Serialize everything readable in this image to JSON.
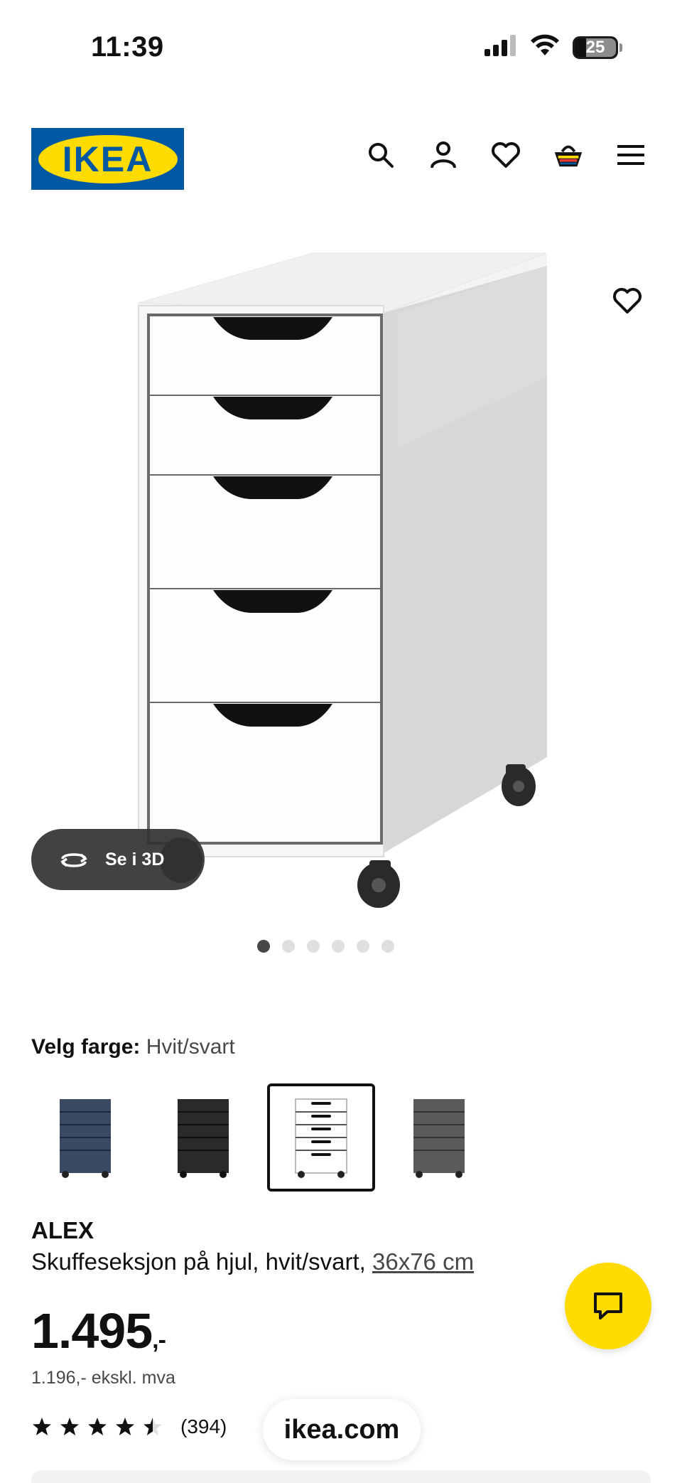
{
  "status_bar": {
    "time": "11:39",
    "battery": "25"
  },
  "header": {
    "logo_text": "IKEA",
    "brand_colors": {
      "blue": "#0058a3",
      "yellow": "#ffdb00"
    },
    "icons": [
      "search-icon",
      "account-icon",
      "heart-icon",
      "basket-icon",
      "menu-icon"
    ]
  },
  "gallery": {
    "view_3d_label": "Se i 3D",
    "dots_count": 6,
    "active_dot": 0
  },
  "color": {
    "label": "Velg farge:",
    "value": "Hvit/svart",
    "swatches": [
      {
        "name": "blue",
        "color": "#3a4a63"
      },
      {
        "name": "black",
        "color": "#2a2a2a"
      },
      {
        "name": "white",
        "color": "#ffffff",
        "selected": true
      },
      {
        "name": "grey",
        "color": "#5a5a5a"
      }
    ]
  },
  "product": {
    "name": "ALEX",
    "description": "Skuffeseksjon på hjul, hvit/svart,",
    "size": "36x76 cm",
    "price": "1.495",
    "price_suffix": ",-",
    "price_ex_vat": "1.196,- ekskl. mva",
    "rating": 4.5,
    "rating_count": "(394)"
  },
  "browser": {
    "url": "ikea.com"
  }
}
